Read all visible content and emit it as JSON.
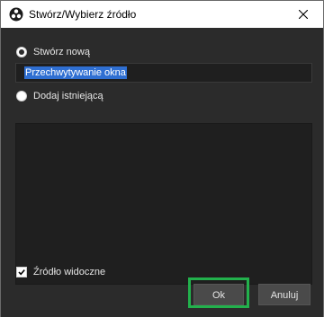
{
  "window": {
    "title": "Stwórz/Wybierz źródło",
    "close_icon": "close-icon",
    "app_icon": "obs-icon"
  },
  "form": {
    "create_new_label": "Stwórz nową",
    "create_new_selected": true,
    "name_value": "Przechwytywanie okna",
    "add_existing_label": "Dodaj istniejącą",
    "add_existing_selected": false,
    "visible_label": "Źródło widoczne",
    "visible_checked": true
  },
  "buttons": {
    "ok_label": "Ok",
    "cancel_label": "Anuluj"
  },
  "colors": {
    "highlight": "#22b14c",
    "selection": "#2f6fd2",
    "background": "#2b2b2b"
  }
}
